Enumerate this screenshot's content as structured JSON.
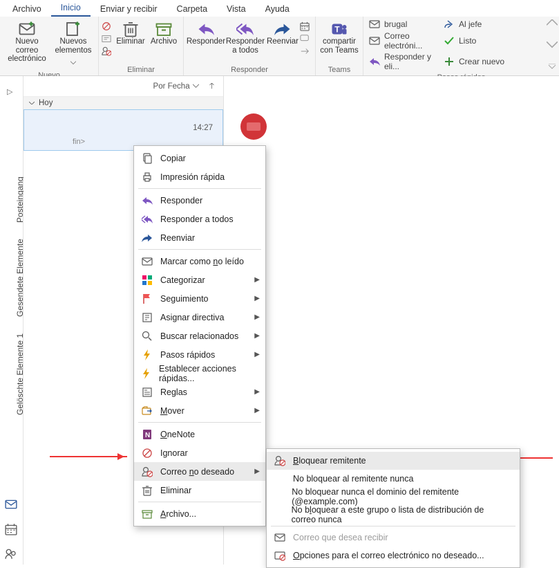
{
  "menubar": {
    "items": [
      "Archivo",
      "Inicio",
      "Enviar y recibir",
      "Carpeta",
      "Vista",
      "Ayuda"
    ],
    "active": 1
  },
  "ribbon": {
    "new": {
      "label": "Nuevo",
      "newmail": "Nuevo correo\nelectrónico",
      "newitems": "Nuevos\nelementos"
    },
    "delete": {
      "label": "Eliminar",
      "delete": "Eliminar",
      "archive": "Archivo"
    },
    "respond": {
      "label": "Responder",
      "reply": "Responder",
      "replyall": "Responder\na todos",
      "forward": "Reenviar"
    },
    "teams": {
      "label": "Teams",
      "share": "compartir\ncon Teams"
    },
    "quicksteps": {
      "label": "Pasos rápidos",
      "rows": [
        [
          {
            "text": "brugal",
            "icon": "mail"
          },
          {
            "text": "Al jefe",
            "icon": "fwd"
          }
        ],
        [
          {
            "text": "Correo electróni...",
            "icon": "mail-done"
          },
          {
            "text": "Listo",
            "icon": "check"
          }
        ],
        [
          {
            "text": "Responder y eli...",
            "icon": "reply"
          },
          {
            "text": "Crear nuevo",
            "icon": "plus"
          }
        ]
      ]
    }
  },
  "folder_rail": {
    "folders": [
      "Posteingang",
      "Gesendete Elemente",
      "Gelöschte Elemente 1"
    ]
  },
  "listpane": {
    "sort_label": "Por Fecha",
    "group_today": "Hoy",
    "msg": {
      "subject_tail": "fin>",
      "time": "14:27"
    }
  },
  "ctx1": [
    {
      "icon": "copy",
      "text": "Copiar",
      "u": ""
    },
    {
      "icon": "print",
      "text": "Impresión rápida",
      "u": ""
    },
    {
      "sep": true
    },
    {
      "icon": "reply",
      "text": "Responder",
      "u": ""
    },
    {
      "icon": "replyall",
      "text": "Responder a todos",
      "u": ""
    },
    {
      "icon": "forward",
      "text": "Reenviar",
      "u": ""
    },
    {
      "sep": true
    },
    {
      "icon": "mail",
      "text": "Marcar como no leído",
      "u": "n"
    },
    {
      "icon": "cat",
      "text": "Categorizar",
      "arrow": true
    },
    {
      "icon": "flag",
      "text": "Seguimiento",
      "arrow": true
    },
    {
      "icon": "policy",
      "text": "Asignar directiva",
      "arrow": true
    },
    {
      "icon": "search",
      "text": "Buscar relacionados",
      "arrow": true
    },
    {
      "icon": "bolt",
      "text": "Pasos rápidos",
      "arrow": true
    },
    {
      "icon": "bolt",
      "text": "Establecer acciones rápidas..."
    },
    {
      "icon": "rules",
      "text": "Reglas",
      "arrow": true
    },
    {
      "icon": "move",
      "text": "Mover",
      "arrow": true,
      "u": "M"
    },
    {
      "sep": true
    },
    {
      "icon": "onenote",
      "text": "OneNote",
      "u": "O"
    },
    {
      "icon": "ignore",
      "text": "Ignorar"
    },
    {
      "icon": "junk",
      "text": "Correo no deseado",
      "arrow": true,
      "highlight": true,
      "u": "n"
    },
    {
      "icon": "trash",
      "text": "Eliminar"
    },
    {
      "sep": true
    },
    {
      "icon": "archive",
      "text": "Archivo...",
      "u": "A"
    }
  ],
  "ctx2": [
    {
      "icon": "block",
      "text": "Bloquear remitente",
      "highlight": true,
      "u": "B"
    },
    {
      "icon": "",
      "text": "No bloquear al remitente nunca"
    },
    {
      "icon": "",
      "text": "No bloquear nunca el dominio del remitente (@example.com)"
    },
    {
      "icon": "",
      "text": "No bloquear a este grupo o lista de distribución de correo nunca",
      "u": "l"
    },
    {
      "sep": true
    },
    {
      "icon": "mail",
      "text": "Correo que desea recibir",
      "disabled": true
    },
    {
      "icon": "junkopt",
      "text": "Opciones para el correo electrónico no deseado...",
      "u": "O"
    }
  ]
}
